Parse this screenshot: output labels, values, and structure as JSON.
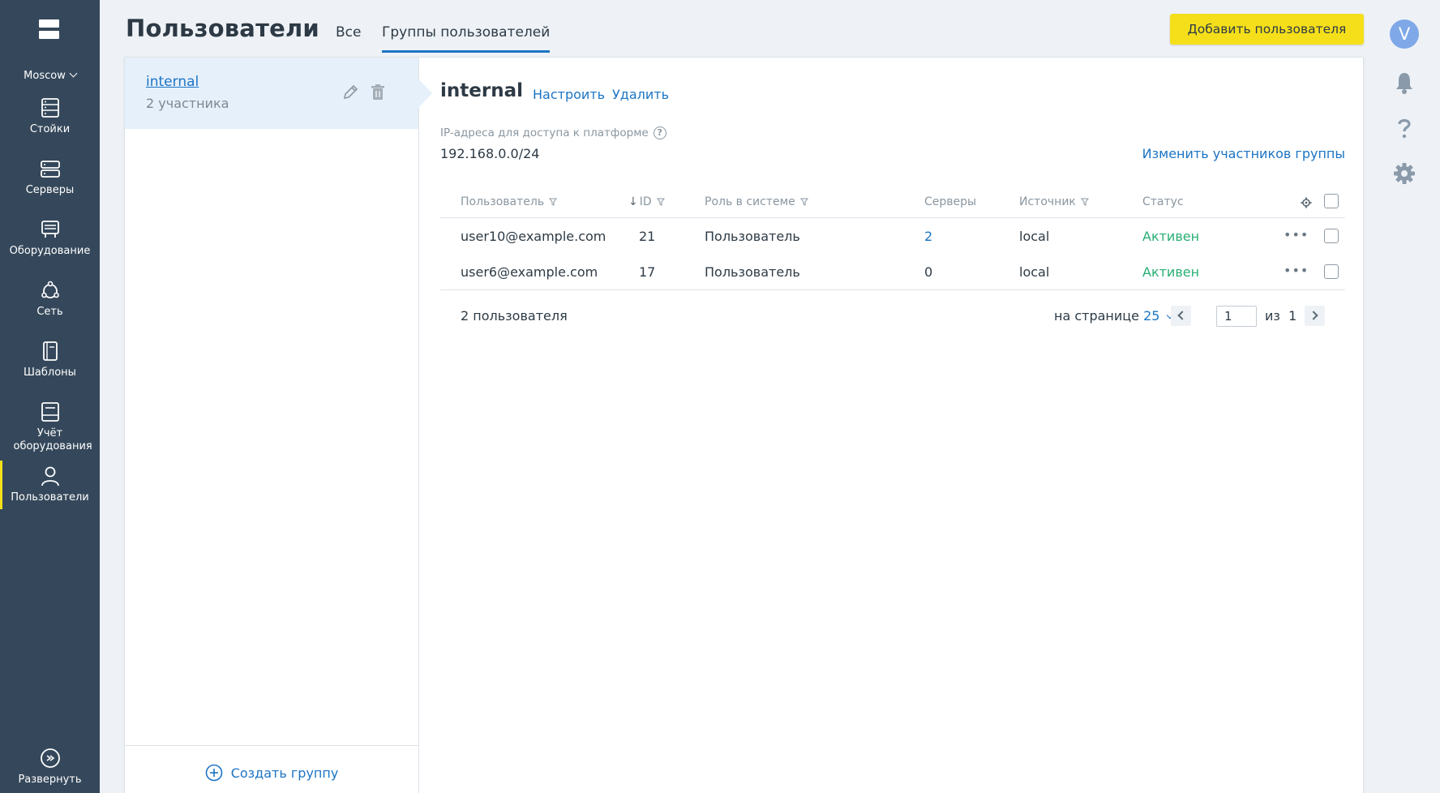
{
  "sidebar": {
    "location": "Moscow",
    "items": [
      {
        "label": "Стойки",
        "icon": "racks-icon"
      },
      {
        "label": "Серверы",
        "icon": "servers-icon"
      },
      {
        "label": "Оборудование",
        "icon": "equipment-icon"
      },
      {
        "label": "Сеть",
        "icon": "network-icon"
      },
      {
        "label": "Шаблоны",
        "icon": "templates-icon"
      },
      {
        "label": "Учёт оборудования",
        "icon": "inventory-icon"
      },
      {
        "label": "Пользователи",
        "icon": "user-icon"
      }
    ],
    "expand_label": "Развернуть"
  },
  "header": {
    "title": "Пользователи",
    "tabs": [
      {
        "label": "Все"
      },
      {
        "label": "Группы пользователей"
      }
    ],
    "add_user_label": "Добавить пользователя",
    "avatar_letter": "V"
  },
  "groups": {
    "items": [
      {
        "name": "internal",
        "count": "2 участника"
      }
    ],
    "create_label": "Создать группу"
  },
  "detail": {
    "name": "internal",
    "configure_label": "Настроить",
    "delete_label": "Удалить",
    "ip_label": "IP-адреса для доступа к платформе",
    "ip_value": "192.168.0.0/24",
    "edit_members_label": "Изменить участников группы"
  },
  "table": {
    "columns": {
      "user": "Пользователь",
      "id": "ID",
      "role": "Роль в системе",
      "servers": "Серверы",
      "source": "Источник",
      "status": "Статус"
    },
    "rows": [
      {
        "user": "user10@example.com",
        "id": "21",
        "role": "Пользователь",
        "servers": "2",
        "source": "local",
        "status": "Активен"
      },
      {
        "user": "user6@example.com",
        "id": "17",
        "role": "Пользователь",
        "servers": "0",
        "source": "local",
        "status": "Активен"
      }
    ],
    "total": "2 пользователя",
    "per_page_label": "на странице",
    "per_page_value": "25",
    "page": "1",
    "of_label": "из",
    "total_pages": "1"
  },
  "colors": {
    "accent": "#1c74c4",
    "primary_button": "#f5df1a",
    "sidebar": "#35485b",
    "status_active": "#27ae73"
  }
}
